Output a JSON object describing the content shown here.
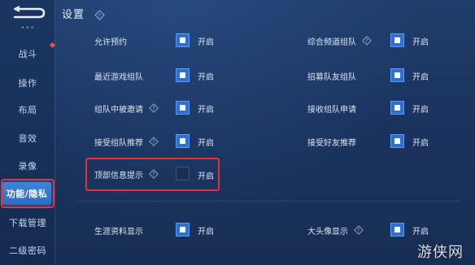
{
  "header": {
    "title": "设置"
  },
  "sidebar": {
    "items": [
      {
        "label": "战斗"
      },
      {
        "label": "操作"
      },
      {
        "label": "布局"
      },
      {
        "label": "音效"
      },
      {
        "label": "录像"
      },
      {
        "label": "功能/隐私",
        "active": true
      },
      {
        "label": "下载管理"
      },
      {
        "label": "二级密码"
      }
    ]
  },
  "toggle_text": "开启",
  "settings": {
    "allow_reservation": {
      "label": "允许预约",
      "checked": true
    },
    "recent_game_team": {
      "label": "最近游戏组队",
      "checked": true
    },
    "in_team_invite": {
      "label": "组队中被邀请",
      "checked": true
    },
    "accept_team_recommend": {
      "label": "接受组队推荐",
      "checked": true
    },
    "top_info_tip": {
      "label": "顶部信息提示",
      "checked": false
    },
    "career_info_show": {
      "label": "生涯资料显示",
      "checked": true
    },
    "general_channel_team": {
      "label": "综合频道组队",
      "checked": true
    },
    "recruit_teammates": {
      "label": "招募队友组队",
      "checked": true
    },
    "receive_team_request": {
      "label": "接收组队申请",
      "checked": true
    },
    "accept_friend_recommend": {
      "label": "接受好友推荐",
      "checked": true
    },
    "big_avatar_show": {
      "label": "大头像显示",
      "checked": true
    }
  },
  "watermark": "游侠网",
  "colors": {
    "accent": "#2f6fd0",
    "highlight": "#e0343a",
    "active_tab": "#3f84d8"
  },
  "icons": {
    "back": "back-arrow-icon",
    "help": "question-diamond-icon"
  }
}
